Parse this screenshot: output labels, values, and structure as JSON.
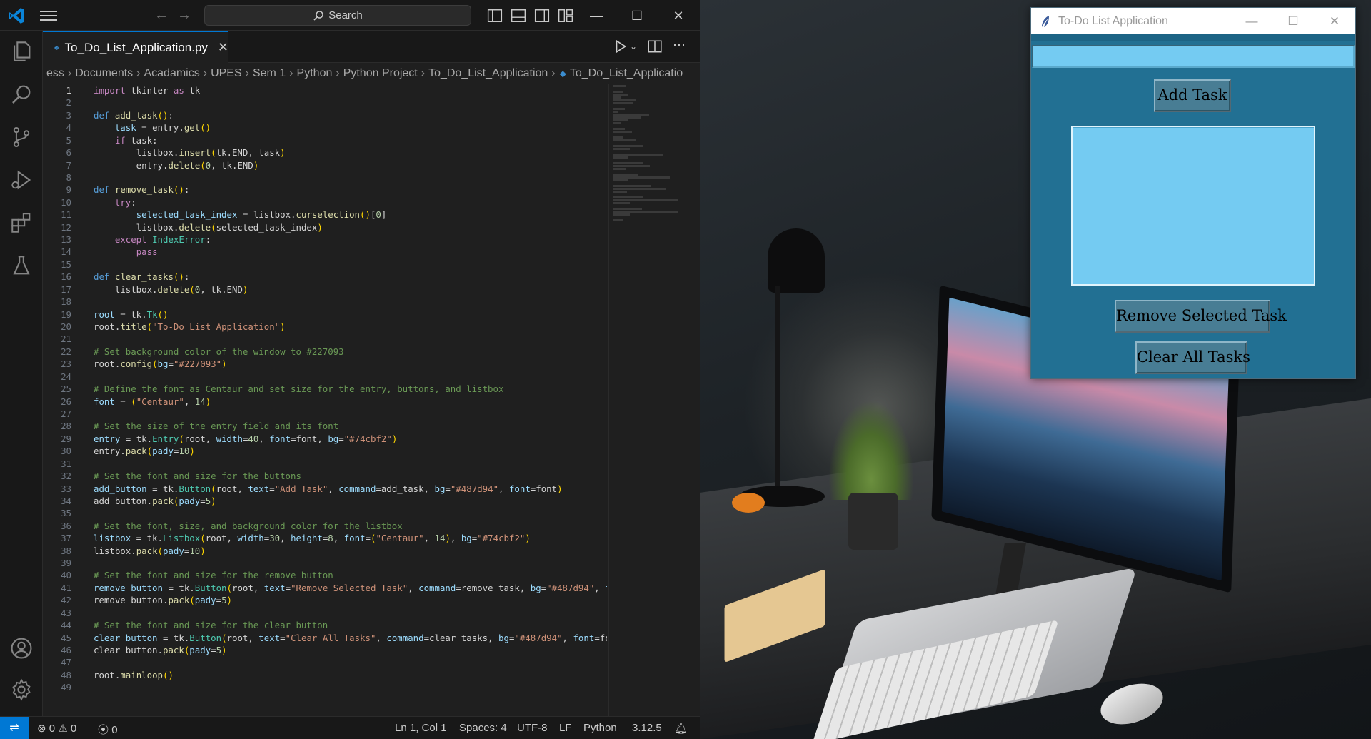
{
  "vscode": {
    "search_label": "Search",
    "tab": {
      "filename": "To_Do_List_Application.py"
    },
    "breadcrumb": [
      "ess",
      "Documents",
      "Acadamics",
      "UPES",
      "Sem 1",
      "Python",
      "Python Project",
      "To_Do_List_Application",
      "To_Do_List_Applicatio"
    ],
    "status": {
      "errors": "0",
      "warnings": "0",
      "ports": "0",
      "cursor": "Ln 1, Col 1",
      "spaces": "Spaces: 4",
      "encoding": "UTF-8",
      "eol": "LF",
      "language": "Python",
      "version": "3.12.5"
    },
    "code_lines": [
      [
        [
          "kw",
          "import"
        ],
        [
          "pl",
          " tkinter "
        ],
        [
          "kw",
          "as"
        ],
        [
          "pl",
          " tk"
        ]
      ],
      [],
      [
        [
          "kw2",
          "def"
        ],
        [
          "pl",
          " "
        ],
        [
          "fn",
          "add_task"
        ],
        [
          "br",
          "()"
        ],
        [
          "pl",
          ":"
        ]
      ],
      [
        [
          "pl",
          "    "
        ],
        [
          "var",
          "task"
        ],
        [
          "pl",
          " = entry."
        ],
        [
          "fn",
          "get"
        ],
        [
          "br",
          "()"
        ]
      ],
      [
        [
          "pl",
          "    "
        ],
        [
          "kw",
          "if"
        ],
        [
          "pl",
          " task:"
        ]
      ],
      [
        [
          "pl",
          "        listbox."
        ],
        [
          "fn",
          "insert"
        ],
        [
          "br",
          "("
        ],
        [
          "pl",
          "tk.END, task"
        ],
        [
          "br",
          ")"
        ]
      ],
      [
        [
          "pl",
          "        entry."
        ],
        [
          "fn",
          "delete"
        ],
        [
          "br",
          "("
        ],
        [
          "num",
          "0"
        ],
        [
          "pl",
          ", tk.END"
        ],
        [
          "br",
          ")"
        ]
      ],
      [],
      [
        [
          "kw2",
          "def"
        ],
        [
          "pl",
          " "
        ],
        [
          "fn",
          "remove_task"
        ],
        [
          "br",
          "()"
        ],
        [
          "pl",
          ":"
        ]
      ],
      [
        [
          "pl",
          "    "
        ],
        [
          "kw",
          "try"
        ],
        [
          "pl",
          ":"
        ]
      ],
      [
        [
          "pl",
          "        "
        ],
        [
          "var",
          "selected_task_index"
        ],
        [
          "pl",
          " = listbox."
        ],
        [
          "fn",
          "curselection"
        ],
        [
          "br",
          "()"
        ],
        [
          "pl",
          "["
        ],
        [
          "num",
          "0"
        ],
        [
          "pl",
          "]"
        ]
      ],
      [
        [
          "pl",
          "        listbox."
        ],
        [
          "fn",
          "delete"
        ],
        [
          "br",
          "("
        ],
        [
          "pl",
          "selected_task_index"
        ],
        [
          "br",
          ")"
        ]
      ],
      [
        [
          "pl",
          "    "
        ],
        [
          "kw",
          "except"
        ],
        [
          "pl",
          " "
        ],
        [
          "cls",
          "IndexError"
        ],
        [
          "pl",
          ":"
        ]
      ],
      [
        [
          "pl",
          "        "
        ],
        [
          "kw",
          "pass"
        ]
      ],
      [],
      [
        [
          "kw2",
          "def"
        ],
        [
          "pl",
          " "
        ],
        [
          "fn",
          "clear_tasks"
        ],
        [
          "br",
          "()"
        ],
        [
          "pl",
          ":"
        ]
      ],
      [
        [
          "pl",
          "    listbox."
        ],
        [
          "fn",
          "delete"
        ],
        [
          "br",
          "("
        ],
        [
          "num",
          "0"
        ],
        [
          "pl",
          ", tk.END"
        ],
        [
          "br",
          ")"
        ]
      ],
      [],
      [
        [
          "var",
          "root"
        ],
        [
          "pl",
          " = tk."
        ],
        [
          "cls",
          "Tk"
        ],
        [
          "br",
          "()"
        ]
      ],
      [
        [
          "pl",
          "root."
        ],
        [
          "fn",
          "title"
        ],
        [
          "br",
          "("
        ],
        [
          "str",
          "\"To-Do List Application\""
        ],
        [
          "br",
          ")"
        ]
      ],
      [],
      [
        [
          "com",
          "# Set background color of the window to #227093"
        ]
      ],
      [
        [
          "pl",
          "root."
        ],
        [
          "fn",
          "config"
        ],
        [
          "br",
          "("
        ],
        [
          "var",
          "bg"
        ],
        [
          "pl",
          "="
        ],
        [
          "str",
          "\"#227093\""
        ],
        [
          "br",
          ")"
        ]
      ],
      [],
      [
        [
          "com",
          "# Define the font as Centaur and set size for the entry, buttons, and listbox"
        ]
      ],
      [
        [
          "var",
          "font"
        ],
        [
          "pl",
          " = "
        ],
        [
          "br",
          "("
        ],
        [
          "str",
          "\"Centaur\""
        ],
        [
          "pl",
          ", "
        ],
        [
          "num",
          "14"
        ],
        [
          "br",
          ")"
        ]
      ],
      [],
      [
        [
          "com",
          "# Set the size of the entry field and its font"
        ]
      ],
      [
        [
          "var",
          "entry"
        ],
        [
          "pl",
          " = tk."
        ],
        [
          "cls",
          "Entry"
        ],
        [
          "br",
          "("
        ],
        [
          "pl",
          "root, "
        ],
        [
          "var",
          "width"
        ],
        [
          "pl",
          "="
        ],
        [
          "num",
          "40"
        ],
        [
          "pl",
          ", "
        ],
        [
          "var",
          "font"
        ],
        [
          "pl",
          "=font, "
        ],
        [
          "var",
          "bg"
        ],
        [
          "pl",
          "="
        ],
        [
          "str",
          "\"#74cbf2\""
        ],
        [
          "br",
          ")"
        ]
      ],
      [
        [
          "pl",
          "entry."
        ],
        [
          "fn",
          "pack"
        ],
        [
          "br",
          "("
        ],
        [
          "var",
          "pady"
        ],
        [
          "pl",
          "="
        ],
        [
          "num",
          "10"
        ],
        [
          "br",
          ")"
        ]
      ],
      [],
      [
        [
          "com",
          "# Set the font and size for the buttons"
        ]
      ],
      [
        [
          "var",
          "add_button"
        ],
        [
          "pl",
          " = tk."
        ],
        [
          "cls",
          "Button"
        ],
        [
          "br",
          "("
        ],
        [
          "pl",
          "root, "
        ],
        [
          "var",
          "text"
        ],
        [
          "pl",
          "="
        ],
        [
          "str",
          "\"Add Task\""
        ],
        [
          "pl",
          ", "
        ],
        [
          "var",
          "command"
        ],
        [
          "pl",
          "=add_task, "
        ],
        [
          "var",
          "bg"
        ],
        [
          "pl",
          "="
        ],
        [
          "str",
          "\"#487d94\""
        ],
        [
          "pl",
          ", "
        ],
        [
          "var",
          "font"
        ],
        [
          "pl",
          "=font"
        ],
        [
          "br",
          ")"
        ]
      ],
      [
        [
          "pl",
          "add_button."
        ],
        [
          "fn",
          "pack"
        ],
        [
          "br",
          "("
        ],
        [
          "var",
          "pady"
        ],
        [
          "pl",
          "="
        ],
        [
          "num",
          "5"
        ],
        [
          "br",
          ")"
        ]
      ],
      [],
      [
        [
          "com",
          "# Set the font, size, and background color for the listbox"
        ]
      ],
      [
        [
          "var",
          "listbox"
        ],
        [
          "pl",
          " = tk."
        ],
        [
          "cls",
          "Listbox"
        ],
        [
          "br",
          "("
        ],
        [
          "pl",
          "root, "
        ],
        [
          "var",
          "width"
        ],
        [
          "pl",
          "="
        ],
        [
          "num",
          "30"
        ],
        [
          "pl",
          ", "
        ],
        [
          "var",
          "height"
        ],
        [
          "pl",
          "="
        ],
        [
          "num",
          "8"
        ],
        [
          "pl",
          ", "
        ],
        [
          "var",
          "font"
        ],
        [
          "pl",
          "="
        ],
        [
          "br",
          "("
        ],
        [
          "str",
          "\"Centaur\""
        ],
        [
          "pl",
          ", "
        ],
        [
          "num",
          "14"
        ],
        [
          "br",
          ")"
        ],
        [
          "pl",
          ", "
        ],
        [
          "var",
          "bg"
        ],
        [
          "pl",
          "="
        ],
        [
          "str",
          "\"#74cbf2\""
        ],
        [
          "br",
          ")"
        ]
      ],
      [
        [
          "pl",
          "listbox."
        ],
        [
          "fn",
          "pack"
        ],
        [
          "br",
          "("
        ],
        [
          "var",
          "pady"
        ],
        [
          "pl",
          "="
        ],
        [
          "num",
          "10"
        ],
        [
          "br",
          ")"
        ]
      ],
      [],
      [
        [
          "com",
          "# Set the font and size for the remove button"
        ]
      ],
      [
        [
          "var",
          "remove_button"
        ],
        [
          "pl",
          " = tk."
        ],
        [
          "cls",
          "Button"
        ],
        [
          "br",
          "("
        ],
        [
          "pl",
          "root, "
        ],
        [
          "var",
          "text"
        ],
        [
          "pl",
          "="
        ],
        [
          "str",
          "\"Remove Selected Task\""
        ],
        [
          "pl",
          ", "
        ],
        [
          "var",
          "command"
        ],
        [
          "pl",
          "=remove_task, "
        ],
        [
          "var",
          "bg"
        ],
        [
          "pl",
          "="
        ],
        [
          "str",
          "\"#487d94\""
        ],
        [
          "pl",
          ", "
        ],
        [
          "var",
          "font"
        ],
        [
          "pl",
          "=fon"
        ]
      ],
      [
        [
          "pl",
          "remove_button."
        ],
        [
          "fn",
          "pack"
        ],
        [
          "br",
          "("
        ],
        [
          "var",
          "pady"
        ],
        [
          "pl",
          "="
        ],
        [
          "num",
          "5"
        ],
        [
          "br",
          ")"
        ]
      ],
      [],
      [
        [
          "com",
          "# Set the font and size for the clear button"
        ]
      ],
      [
        [
          "var",
          "clear_button"
        ],
        [
          "pl",
          " = tk."
        ],
        [
          "cls",
          "Button"
        ],
        [
          "br",
          "("
        ],
        [
          "pl",
          "root, "
        ],
        [
          "var",
          "text"
        ],
        [
          "pl",
          "="
        ],
        [
          "str",
          "\"Clear All Tasks\""
        ],
        [
          "pl",
          ", "
        ],
        [
          "var",
          "command"
        ],
        [
          "pl",
          "=clear_tasks, "
        ],
        [
          "var",
          "bg"
        ],
        [
          "pl",
          "="
        ],
        [
          "str",
          "\"#487d94\""
        ],
        [
          "pl",
          ", "
        ],
        [
          "var",
          "font"
        ],
        [
          "pl",
          "=font"
        ],
        [
          "br",
          ")"
        ]
      ],
      [
        [
          "pl",
          "clear_button."
        ],
        [
          "fn",
          "pack"
        ],
        [
          "br",
          "("
        ],
        [
          "var",
          "pady"
        ],
        [
          "pl",
          "="
        ],
        [
          "num",
          "5"
        ],
        [
          "br",
          ")"
        ]
      ],
      [],
      [
        [
          "pl",
          "root."
        ],
        [
          "fn",
          "mainloop"
        ],
        [
          "br",
          "()"
        ]
      ],
      []
    ]
  },
  "tk_app": {
    "title": "To-Do List Application",
    "entry_value": "",
    "add_label": "Add Task",
    "remove_label": "Remove Selected Task",
    "clear_label": "Clear All Tasks",
    "list_items": [],
    "colors": {
      "window_bg": "#227093",
      "entry_bg": "#74cbf2",
      "button_bg": "#487d94"
    }
  },
  "icons": {
    "vscode_logo": "vscode-logo-icon",
    "explorer": "files-icon",
    "search": "search-icon",
    "scm": "source-control-icon",
    "debug": "run-debug-icon",
    "extensions": "extensions-icon",
    "testing": "flask-icon",
    "account": "account-icon",
    "settings": "gear-icon",
    "python_file": "python-file-icon",
    "tk_app": "feather-icon"
  },
  "colors": {
    "accent": "#0078d4"
  }
}
